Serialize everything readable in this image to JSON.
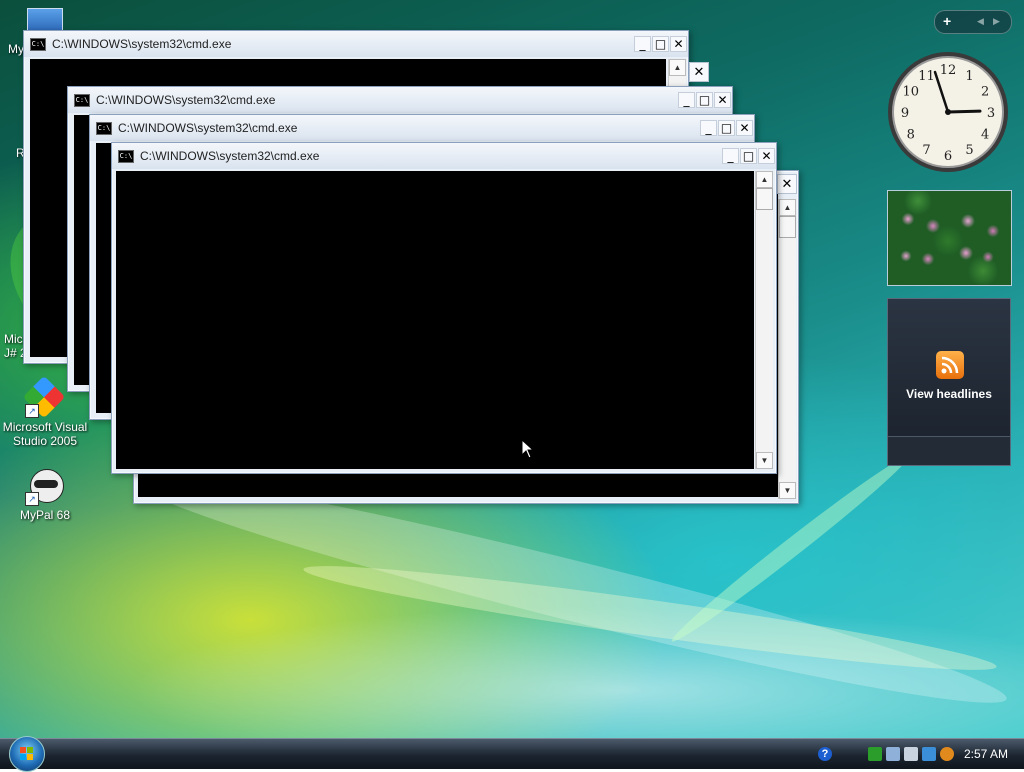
{
  "desktop": {
    "icons": [
      {
        "label": "My"
      },
      {
        "label": "R"
      },
      {
        "label": "Mic\nJ# 2"
      },
      {
        "label": "Microsoft Visual\nStudio 2005"
      },
      {
        "label": "MyPal 68"
      }
    ]
  },
  "windows": [
    {
      "title": "C:\\WINDOWS\\system32\\cmd.exe"
    },
    {
      "title": "C:\\WINDOWS\\system32\\cmd.exe"
    },
    {
      "title": "C:\\WINDOWS\\system32\\cmd.exe"
    },
    {
      "title": "C:\\WINDOWS\\system32\\cmd.exe"
    }
  ],
  "window_controls": {
    "minimize": "_",
    "maximize": "□",
    "close": "✕"
  },
  "scroll": {
    "up": "▲",
    "down": "▼"
  },
  "sidebar": {
    "add_label": "+",
    "nav_prev": "◀",
    "nav_next": "▶",
    "feed_label": "View headlines",
    "clock": {
      "hour": 2,
      "minute": 57
    }
  },
  "taskbar": {
    "time": "2:57 AM",
    "help_glyph": "?"
  },
  "icons": {
    "window": "cmd-icon",
    "start": "windows-logo-icon",
    "feed": "rss-icon"
  }
}
